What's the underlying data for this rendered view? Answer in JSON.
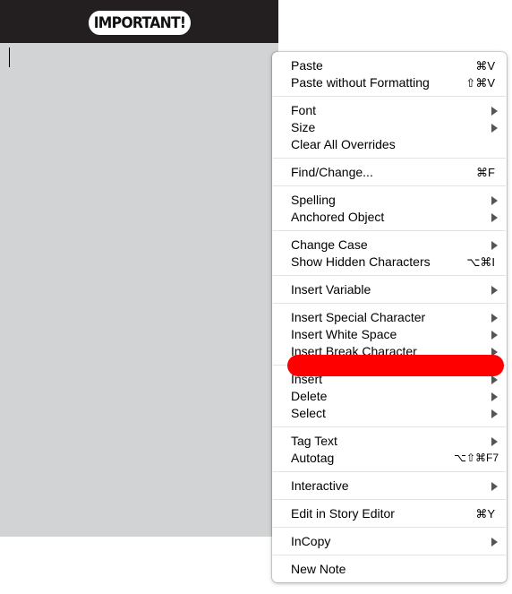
{
  "document": {
    "header_badge": "IMPORTANT!"
  },
  "context_menu": {
    "paste": {
      "label": "Paste",
      "shortcut": "⌘V"
    },
    "paste_without_formatting": {
      "label": "Paste without Formatting",
      "shortcut": "⇧⌘V"
    },
    "font": {
      "label": "Font",
      "submenu": true
    },
    "size": {
      "label": "Size",
      "submenu": true
    },
    "clear_all_overrides": {
      "label": "Clear All Overrides"
    },
    "find_change": {
      "label": "Find/Change...",
      "shortcut": "⌘F"
    },
    "spelling": {
      "label": "Spelling",
      "submenu": true
    },
    "anchored_object": {
      "label": "Anchored Object",
      "submenu": true
    },
    "change_case": {
      "label": "Change Case",
      "submenu": true
    },
    "show_hidden_characters": {
      "label": "Show Hidden Characters",
      "shortcut": "⌥⌘I"
    },
    "insert_variable": {
      "label": "Insert Variable",
      "submenu": true
    },
    "insert_special_character": {
      "label": "Insert Special Character",
      "submenu": true
    },
    "insert_white_space": {
      "label": "Insert White Space",
      "submenu": true
    },
    "insert_break_character": {
      "label": "Insert Break Character",
      "submenu": true
    },
    "insert": {
      "label": "Insert",
      "submenu": true
    },
    "delete": {
      "label": "Delete",
      "submenu": true
    },
    "select": {
      "label": "Select",
      "submenu": true
    },
    "tag_text": {
      "label": "Tag Text",
      "submenu": true
    },
    "autotag": {
      "label": "Autotag",
      "shortcut": "⌥⇧⌘F7"
    },
    "interactive": {
      "label": "Interactive",
      "submenu": true
    },
    "edit_in_story_editor": {
      "label": "Edit in Story Editor",
      "shortcut": "⌘Y"
    },
    "incopy": {
      "label": "InCopy",
      "submenu": true
    },
    "new_note": {
      "label": "New Note"
    }
  },
  "colors": {
    "header_background": "#231f20",
    "text_frame_background": "#d1d3d4",
    "redaction_mark": "#ff0000"
  }
}
